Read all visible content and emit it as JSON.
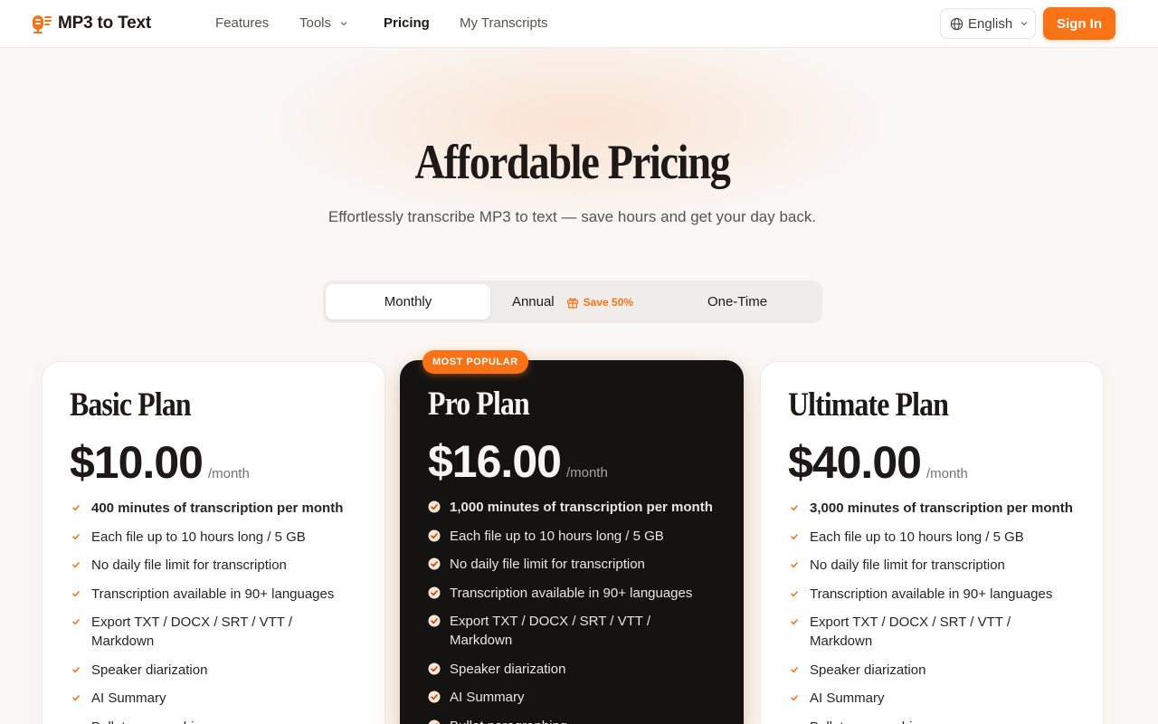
{
  "brand": {
    "name": "MP3 to Text",
    "icon": "microphone-icon",
    "accent": "#f97316"
  },
  "nav": {
    "links": [
      "Features",
      "Tools",
      "Pricing",
      "My Transcripts"
    ],
    "active": "Pricing",
    "language": "English",
    "sign_in": "Sign In"
  },
  "hero": {
    "title": "Affordable Pricing",
    "subtitle": "Effortlessly transcribe MP3 to text — save hours and get your day back."
  },
  "billing_toggle": {
    "options": [
      "Monthly",
      "Annual",
      "One-Time"
    ],
    "selected": "Monthly",
    "annual_badge": "Save 50%"
  },
  "plans": [
    {
      "name": "Basic Plan",
      "price": "$10.00",
      "period": "/month",
      "popular": false,
      "features": [
        "400 minutes of transcription per month",
        "Each file up to 10 hours long / 5 GB",
        "No daily file limit for transcription",
        "Transcription available in 90+ languages",
        "Export TXT / DOCX / SRT / VTT / Markdown",
        "Speaker diarization",
        "AI Summary",
        "Bullet paragraphing"
      ]
    },
    {
      "name": "Pro Plan",
      "price": "$16.00",
      "period": "/month",
      "popular": true,
      "badge": "MOST POPULAR",
      "features": [
        "1,000 minutes of transcription per month",
        "Each file up to 10 hours long / 5 GB",
        "No daily file limit for transcription",
        "Transcription available in 90+ languages",
        "Export TXT / DOCX / SRT / VTT / Markdown",
        "Speaker diarization",
        "AI Summary",
        "Bullet paragraphing"
      ]
    },
    {
      "name": "Ultimate Plan",
      "price": "$40.00",
      "period": "/month",
      "popular": false,
      "features": [
        "3,000 minutes of transcription per month",
        "Each file up to 10 hours long / 5 GB",
        "No daily file limit for transcription",
        "Transcription available in 90+ languages",
        "Export TXT / DOCX / SRT / VTT / Markdown",
        "Speaker diarization",
        "AI Summary",
        "Bullet paragraphing"
      ]
    }
  ]
}
